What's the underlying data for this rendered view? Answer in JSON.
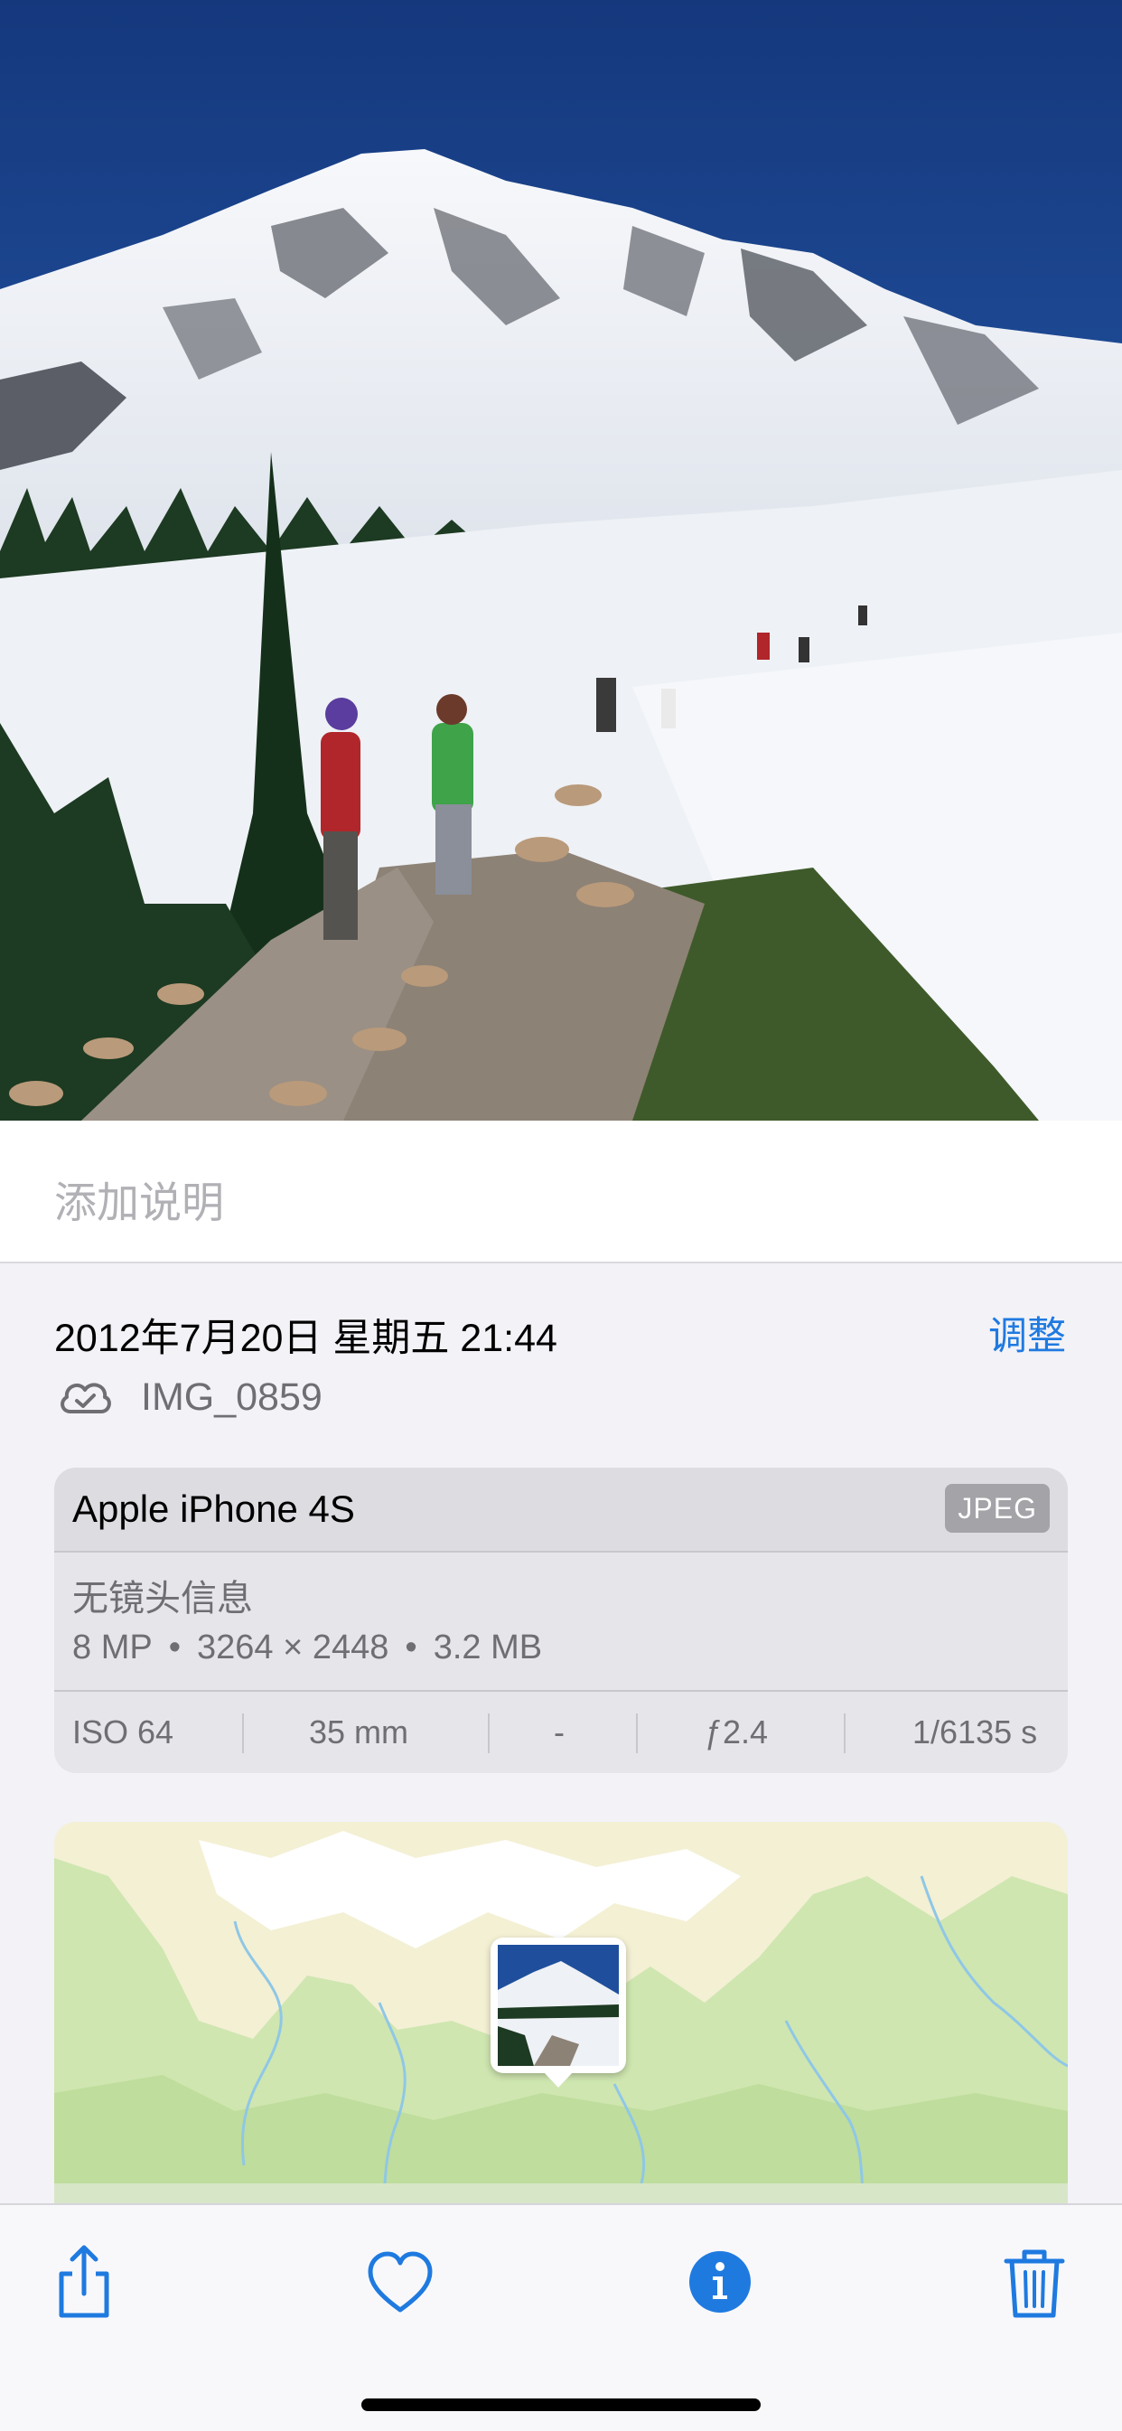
{
  "photo": {
    "description_icon": "photo"
  },
  "caption": {
    "placeholder": "添加说明"
  },
  "info": {
    "date": "2012年7月20日 星期五 21:44",
    "adjust_label": "调整",
    "filename": "IMG_0859",
    "cloud_icon": "cloud-check-icon"
  },
  "device": {
    "name": "Apple iPhone 4S",
    "format": "JPEG",
    "lens": "无镜头信息",
    "megapixels": "8 MP",
    "resolution": "3264 × 2448",
    "size": "3.2 MB",
    "exif": {
      "iso": "ISO 64",
      "focal": "35 mm",
      "ev": "-",
      "aperture": "ƒ2.4",
      "shutter": "1/6135 s"
    }
  },
  "toolbar": {
    "share_icon": "share-icon",
    "favorite_icon": "heart-icon",
    "info_icon": "info-icon",
    "delete_icon": "trash-icon"
  },
  "colors": {
    "accent": "#1f7ae0",
    "background": "#f2f2f7",
    "sky": "#1d4fa3",
    "map_green": "#cfe6b0",
    "map_sand": "#f5f1d6"
  }
}
